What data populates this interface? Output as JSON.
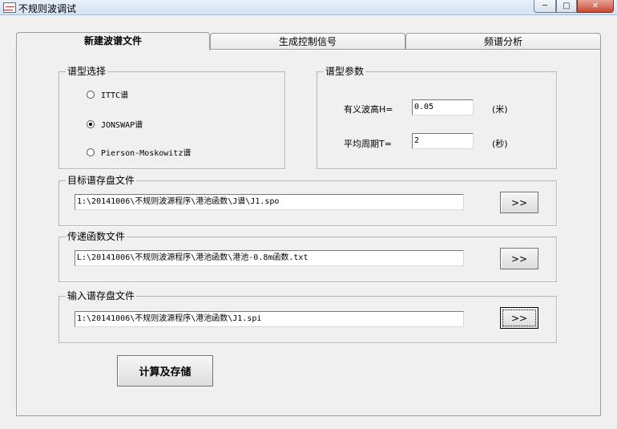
{
  "window": {
    "title": "不规则波调试",
    "minimize_glyph": "─",
    "maximize_glyph": "□",
    "close_glyph": "✕"
  },
  "tabs": [
    {
      "label": "新建波谱文件",
      "active": true
    },
    {
      "label": "生成控制信号",
      "active": false
    },
    {
      "label": "频谱分析",
      "active": false
    }
  ],
  "spectrum_select": {
    "legend": "谱型选择",
    "options": [
      {
        "label": "ITTC谱",
        "checked": false
      },
      {
        "label": "JONSWAP谱",
        "checked": true
      },
      {
        "label": "Pierson-Moskowitz谱",
        "checked": false
      }
    ]
  },
  "spectrum_params": {
    "legend": "谱型参数",
    "wave_height_label": "有义波高H=",
    "wave_height_value": "0.05",
    "wave_height_unit": "(米)",
    "period_label": "平均周期T=",
    "period_value": "2",
    "period_unit": "(秒)"
  },
  "target_file": {
    "legend": "目标谱存盘文件",
    "path": "1:\\20141006\\不规则波源程序\\港池函数\\J谱\\J1.spo",
    "browse_label": ">>"
  },
  "transfer_file": {
    "legend": "传递函数文件",
    "path": "L:\\20141006\\不规则波源程序\\港池函数\\港池-0.8m函数.txt",
    "browse_label": ">>"
  },
  "input_file": {
    "legend": "输入谱存盘文件",
    "path": "1:\\20141006\\不规则波源程序\\港池函数\\J1.spi",
    "browse_label": ">>"
  },
  "compute_button": "计算及存储"
}
